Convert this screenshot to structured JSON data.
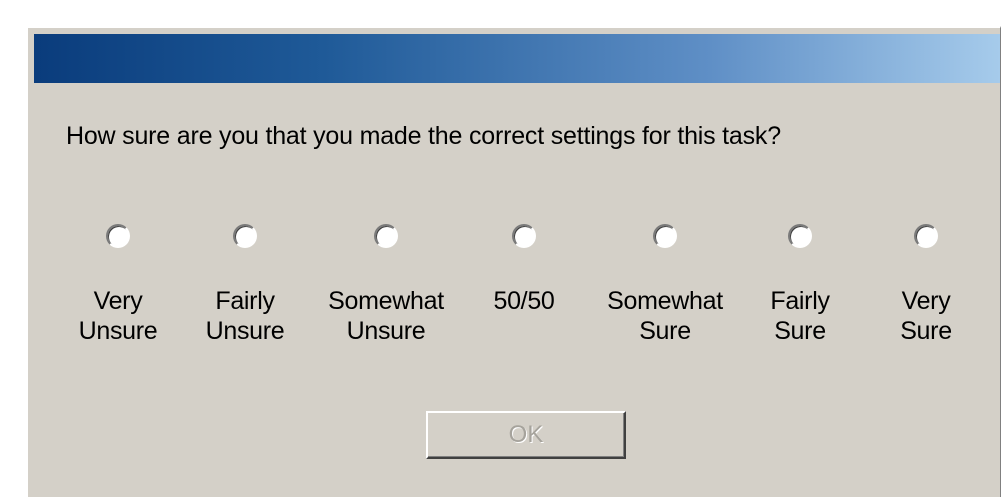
{
  "dialog": {
    "title": "",
    "question": "How sure are you that you made the correct settings for this task?",
    "options": [
      {
        "label": "Very\nUnsure"
      },
      {
        "label": "Fairly\nUnsure"
      },
      {
        "label": "Somewhat\nUnsure"
      },
      {
        "label": "50/50"
      },
      {
        "label": "Somewhat\nSure"
      },
      {
        "label": "Fairly\nSure"
      },
      {
        "label": "Very\nSure"
      }
    ],
    "selected_option": null,
    "ok_button": {
      "label": "OK",
      "enabled": false
    }
  },
  "colors": {
    "dialog_background": "#d4d0c8",
    "titlebar_start": "#0a3c7c",
    "titlebar_end": "#a6cbeb",
    "disabled_text": "#a6a39c"
  }
}
